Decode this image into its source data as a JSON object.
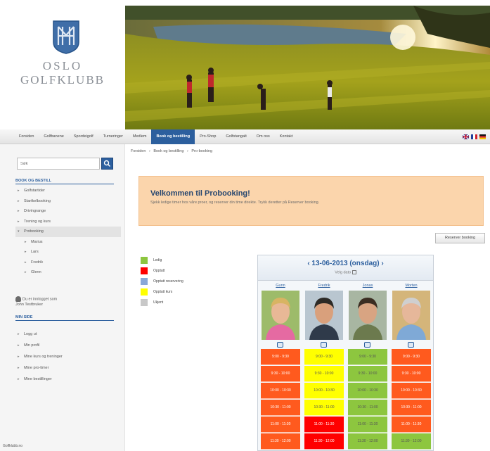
{
  "colors": {
    "nav_active": "#2c5f9e",
    "welcome_bg": "#fbd5ac",
    "ledig": "#8dc63f",
    "opptatt": "#ff0000",
    "opptatt_reservering": "#8aa8d8",
    "opptatt_kurs": "#ffff00",
    "ukjent": "#c8c8c8",
    "slot_orange": "#ff5a1e"
  },
  "logo": {
    "line1": "OSLO",
    "line2": "GOLFKLUBB"
  },
  "nav": {
    "items": [
      {
        "label": "Forsiden"
      },
      {
        "label": "Golfbanene"
      },
      {
        "label": "Spordeigolf"
      },
      {
        "label": "Turneringer"
      },
      {
        "label": "Medlem"
      },
      {
        "label": "Book og bestilling",
        "active": true
      },
      {
        "label": "Pro-Shop"
      },
      {
        "label": "Golfstangalt"
      },
      {
        "label": "Om oss"
      },
      {
        "label": "Kontakt"
      }
    ]
  },
  "sidebar": {
    "search_placeholder": "Søk",
    "section1_title": "BOOK OG BESTILL",
    "items": [
      {
        "label": "Golfstartider"
      },
      {
        "label": "Startkelbooking"
      },
      {
        "label": "Drivingrange"
      },
      {
        "label": "Trening og kurs"
      },
      {
        "label": "Probooking",
        "open": true
      },
      {
        "label": "Marius",
        "sub": true
      },
      {
        "label": "Lars",
        "sub": true
      },
      {
        "label": "Fredrik",
        "sub": true
      },
      {
        "label": "Glenn",
        "sub": true
      }
    ],
    "login_note_line1": "Du er innlogget som",
    "login_note_line2": "John Testbruker",
    "section2_title": "MIN SIDE",
    "items2": [
      {
        "label": "Logg ut"
      },
      {
        "label": "Min profil"
      },
      {
        "label": "Mine kurs og treninger"
      },
      {
        "label": "Mine pro-timer"
      },
      {
        "label": "Mine bestillinger"
      }
    ],
    "footer_tag": "Golfklubb.no"
  },
  "breadcrumb": [
    "Forsiden",
    "›",
    "Book og bestilling",
    "›",
    "Pro-booking"
  ],
  "welcome": {
    "title": "Velkommen til Probooking!",
    "text": "Sjekk ledige timer hos våre proer, og reserver din time direkte. Trykk deretter på Reserver booking."
  },
  "reserve_button": "Reserver booking",
  "legend": [
    {
      "label": "Ledig",
      "color": "#8dc63f"
    },
    {
      "label": "Opptatt",
      "color": "#ff0000"
    },
    {
      "label": "Opptatt reservering",
      "color": "#8aa8d8"
    },
    {
      "label": "Opptatt kurs",
      "color": "#ffff00"
    },
    {
      "label": "Ukjent",
      "color": "#c8c8c8"
    }
  ],
  "booking": {
    "date_title": "‹ 13-06-2013 (onsdag) ›",
    "date_sub": "Velg dato",
    "pros": [
      {
        "name": "Gunn",
        "slots": [
          {
            "time": "9:00 - 9:30",
            "color": "#ff5a1e"
          },
          {
            "time": "9:30 - 10:00",
            "color": "#ff5a1e"
          },
          {
            "time": "10:00 - 10:30",
            "color": "#ff5a1e"
          },
          {
            "time": "10:30 - 11:00",
            "color": "#ff5a1e"
          },
          {
            "time": "11:00 - 11:30",
            "color": "#ff5a1e"
          },
          {
            "time": "11:30 - 12:00",
            "color": "#ff5a1e"
          }
        ]
      },
      {
        "name": "Fredrik",
        "slots": [
          {
            "time": "9:00 - 9:30",
            "color": "#ffff00"
          },
          {
            "time": "9:30 - 10:00",
            "color": "#ffff00"
          },
          {
            "time": "10:00 - 10:30",
            "color": "#ffff00"
          },
          {
            "time": "10:30 - 11:00",
            "color": "#ffff00"
          },
          {
            "time": "11:00 - 11:30",
            "color": "#ff0000"
          },
          {
            "time": "11:30 - 12:00",
            "color": "#ff0000"
          }
        ]
      },
      {
        "name": "Jonas",
        "slots": [
          {
            "time": "9:00 - 9:30",
            "color": "#8dc63f"
          },
          {
            "time": "9:30 - 10:00",
            "color": "#8dc63f"
          },
          {
            "time": "10:00 - 10:30",
            "color": "#8dc63f"
          },
          {
            "time": "10:30 - 11:00",
            "color": "#8dc63f"
          },
          {
            "time": "11:00 - 11:30",
            "color": "#8dc63f"
          },
          {
            "time": "11:30 - 12:00",
            "color": "#8dc63f"
          }
        ]
      },
      {
        "name": "Morten",
        "slots": [
          {
            "time": "9:00 - 9:30",
            "color": "#ff5a1e"
          },
          {
            "time": "9:30 - 10:00",
            "color": "#ff5a1e"
          },
          {
            "time": "10:00 - 10:30",
            "color": "#ff5a1e"
          },
          {
            "time": "10:30 - 11:00",
            "color": "#ff5a1e"
          },
          {
            "time": "11:00 - 11:30",
            "color": "#ff5a1e"
          },
          {
            "time": "11:30 - 12:00",
            "color": "#8dc63f"
          }
        ]
      }
    ]
  }
}
